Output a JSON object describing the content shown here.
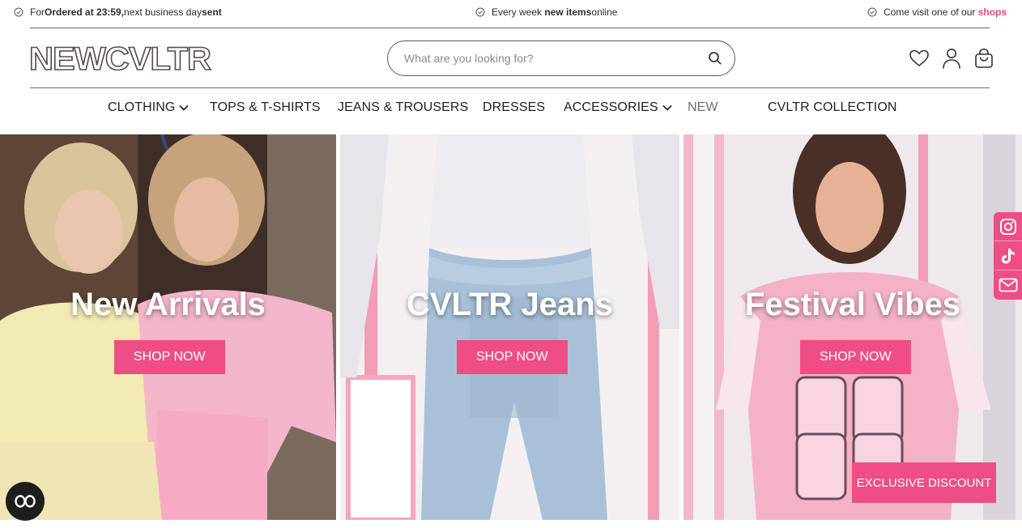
{
  "usp": {
    "item1": {
      "prefix": "For ",
      "bold1": "Ordered at 23:59,",
      "middle": " next business day ",
      "bold2": "sent"
    },
    "item2": {
      "prefix": "Every week ",
      "bold": "new items",
      "suffix": " online"
    },
    "item3": {
      "prefix": "Come visit one of our ",
      "link": "shops"
    }
  },
  "header": {
    "logo_text": "NEWCVLTR",
    "search_placeholder": "What are you looking for?",
    "icons": [
      "heart-icon",
      "user-icon",
      "bag-icon"
    ]
  },
  "nav": {
    "items": [
      {
        "label": "CLOTHING",
        "has_dropdown": true
      },
      {
        "label": "TOPS & T-SHIRTS",
        "has_dropdown": false
      },
      {
        "label": "JEANS & TROUSERS",
        "has_dropdown": false
      },
      {
        "label": "DRESSES",
        "has_dropdown": false
      },
      {
        "label": "ACCESSORIES",
        "has_dropdown": true
      },
      {
        "label": "NEW",
        "has_dropdown": false
      },
      {
        "label": "CVLTR COLLECTION",
        "has_dropdown": false
      }
    ]
  },
  "banners": [
    {
      "title": "New Arrivals",
      "button": "SHOP NOW"
    },
    {
      "title": "CVLTR Jeans",
      "button": "SHOP NOW"
    },
    {
      "title": "Festival Vibes",
      "button": "SHOP NOW"
    }
  ],
  "social": [
    "instagram-icon",
    "tiktok-icon",
    "mail-icon"
  ],
  "discount_button": "EXCLUSIVE DISCOUNT",
  "colors": {
    "accent": "#ee4d86",
    "text": "#1f1f1f"
  }
}
